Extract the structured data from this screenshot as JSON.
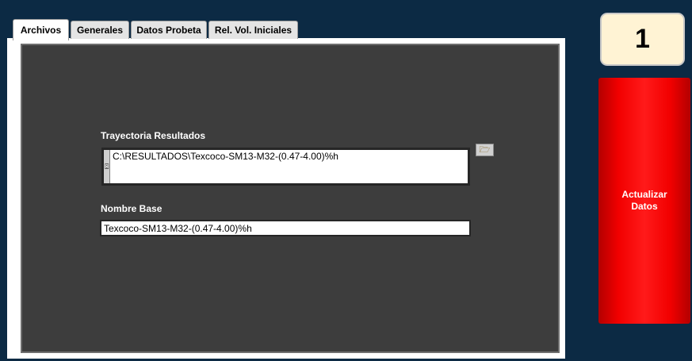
{
  "tabs": [
    {
      "label": "Archivos",
      "active": true
    },
    {
      "label": "Generales",
      "active": false
    },
    {
      "label": "Datos Probeta",
      "active": false
    },
    {
      "label": "Rel. Vol. Iniciales",
      "active": false
    }
  ],
  "archivos": {
    "results_path_label": "Trayectoria Resultados",
    "results_path_value": "C:\\RESULTADOS\\Texcoco-SM13-M32-(0.47-4.00)%h",
    "base_name_label": "Nombre Base",
    "base_name_value": "Texcoco-SM13-M32-(0.47-4.00)%h",
    "browse_icon": "folder-open-icon",
    "path_strip_icon": "path-glyph-icon"
  },
  "counter": {
    "value": "1"
  },
  "update_button": {
    "label": "Actualizar Datos"
  },
  "colors": {
    "background": "#0c2a44",
    "panel": "#3d3d3d",
    "button": "#f20000",
    "counter_fill": "#fff3d4"
  }
}
